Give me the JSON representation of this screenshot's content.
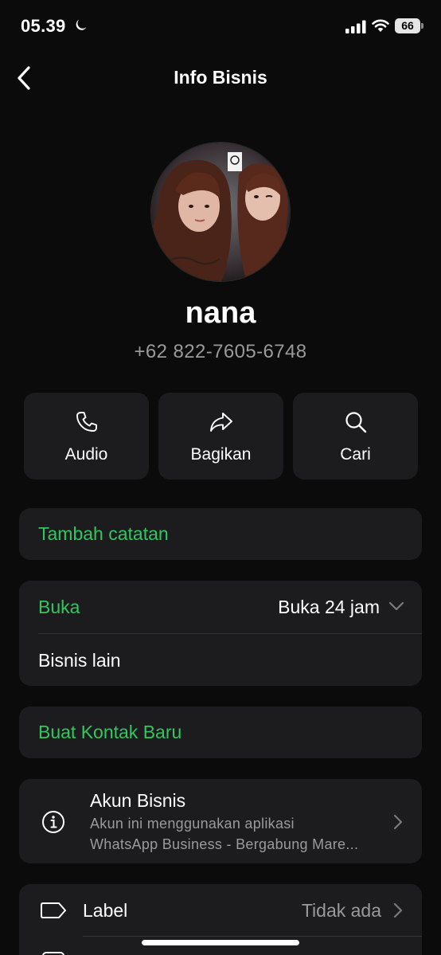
{
  "status_bar": {
    "time": "05.39",
    "battery": "66"
  },
  "nav": {
    "title": "Info Bisnis"
  },
  "profile": {
    "name": "nana",
    "phone": "+62 822-7605-6748"
  },
  "actions": [
    {
      "label": "Audio",
      "icon": "phone-icon"
    },
    {
      "label": "Bagikan",
      "icon": "share-icon"
    },
    {
      "label": "Cari",
      "icon": "search-icon"
    }
  ],
  "notes": {
    "label": "Tambah catatan"
  },
  "hours": {
    "label": "Buka",
    "value": "Buka 24 jam",
    "other": "Bisnis lain"
  },
  "contact": {
    "label": "Buat Kontak Baru"
  },
  "business_account": {
    "title": "Akun Bisnis",
    "line1": "Akun ini menggunakan aplikasi",
    "line2": "WhatsApp Business - Bergabung Mare..."
  },
  "label_row": {
    "label": "Label",
    "value": "Tidak ada"
  },
  "colors": {
    "accent_green": "#30c75e",
    "card_bg": "#1c1c1e",
    "background": "#0b0b0b"
  }
}
